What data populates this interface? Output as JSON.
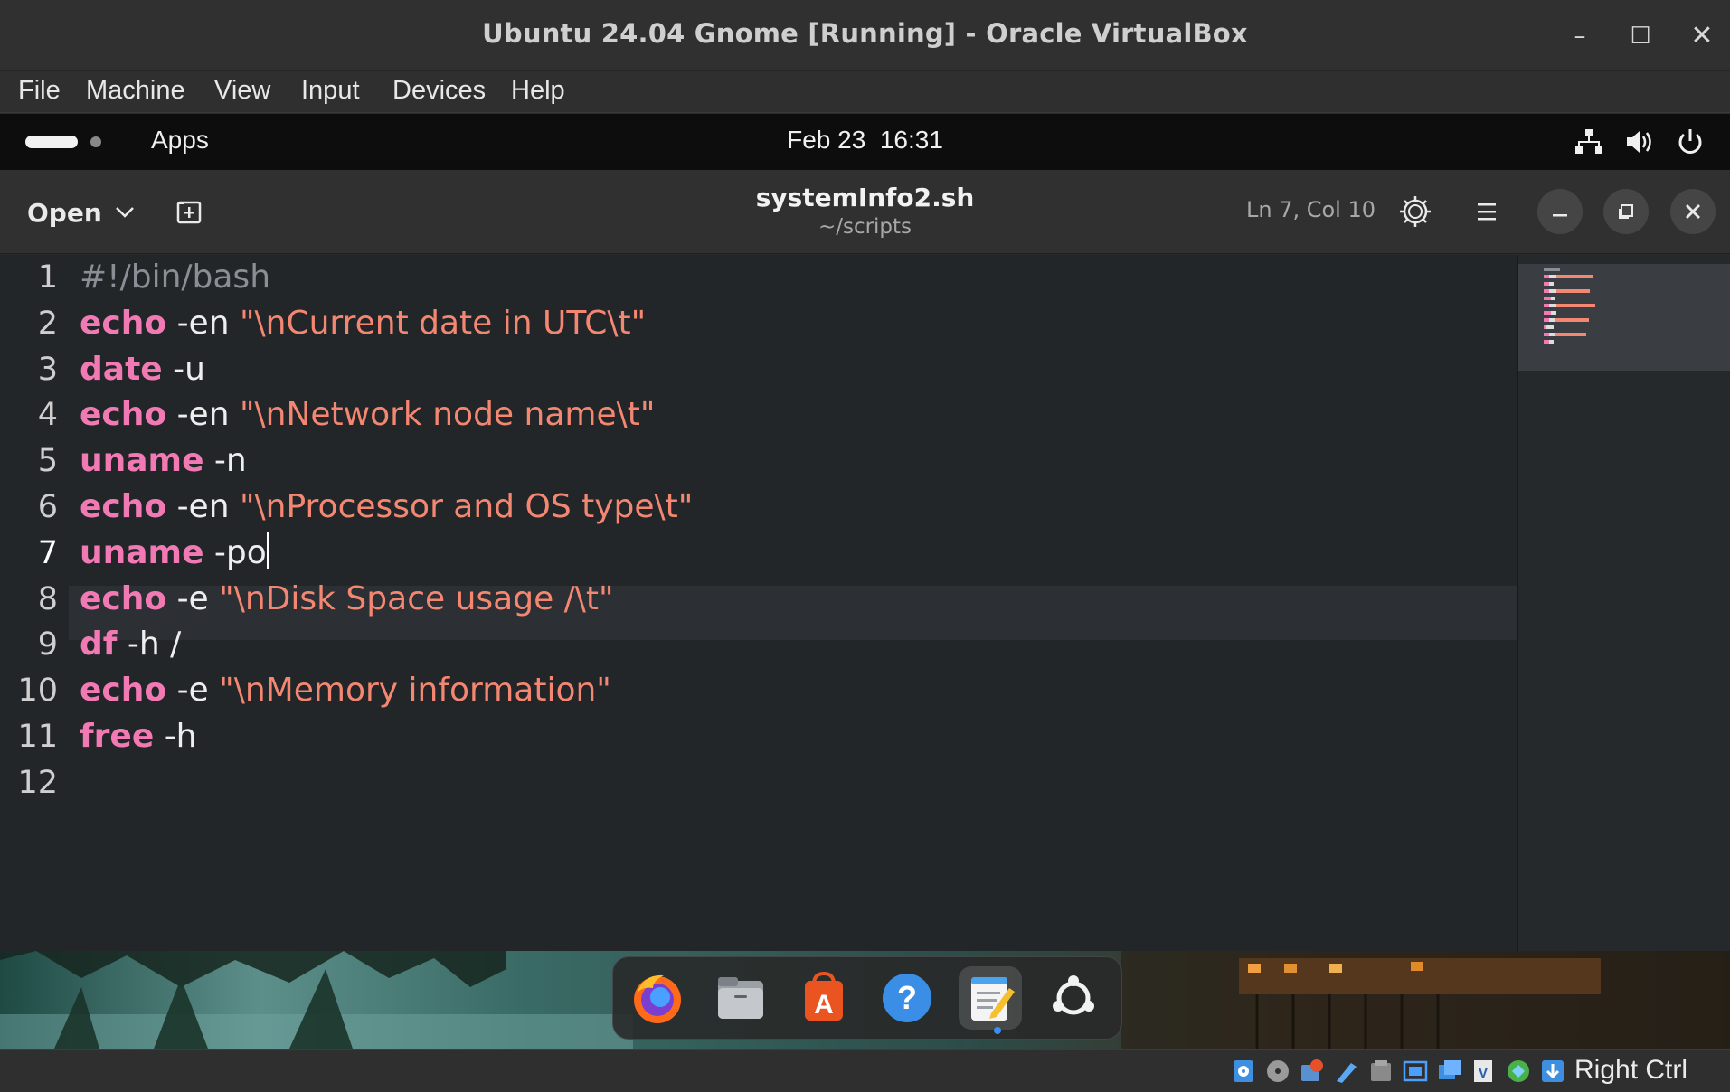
{
  "window": {
    "title": "Ubuntu 24.04 Gnome [Running] - Oracle VirtualBox",
    "controls": {
      "minimize": "–",
      "maximize": "☐",
      "close": "✕"
    }
  },
  "vbox_menu": [
    "File",
    "Machine",
    "View",
    "Input",
    "Devices",
    "Help"
  ],
  "gnome_topbar": {
    "apps_label": "Apps",
    "date": "Feb 23",
    "time": "16:31",
    "tray_icons": [
      "network-icon",
      "volume-icon",
      "power-icon"
    ]
  },
  "gedit": {
    "open_label": "Open",
    "filename": "systemInfo2.sh",
    "path": "~/scripts",
    "cursor_position": "Ln 7, Col 10"
  },
  "editor": {
    "active_line": 7,
    "lines": [
      {
        "num": "1",
        "tokens": [
          {
            "t": "cmt",
            "v": "#!/bin/bash"
          }
        ]
      },
      {
        "num": "2",
        "tokens": [
          {
            "t": "kw",
            "v": "echo"
          },
          {
            "t": "arg",
            "v": " -en "
          },
          {
            "t": "str",
            "v": "\"\\nCurrent date in UTC\\t\""
          }
        ]
      },
      {
        "num": "3",
        "tokens": [
          {
            "t": "kw",
            "v": "date"
          },
          {
            "t": "arg",
            "v": " -u"
          }
        ]
      },
      {
        "num": "4",
        "tokens": [
          {
            "t": "kw",
            "v": "echo"
          },
          {
            "t": "arg",
            "v": " -en "
          },
          {
            "t": "str",
            "v": "\"\\nNetwork node name\\t\""
          }
        ]
      },
      {
        "num": "5",
        "tokens": [
          {
            "t": "kw",
            "v": "uname"
          },
          {
            "t": "arg",
            "v": " -n"
          }
        ]
      },
      {
        "num": "6",
        "tokens": [
          {
            "t": "kw",
            "v": "echo"
          },
          {
            "t": "arg",
            "v": " -en "
          },
          {
            "t": "str",
            "v": "\"\\nProcessor and OS type\\t\""
          }
        ]
      },
      {
        "num": "7",
        "tokens": [
          {
            "t": "kw",
            "v": "uname"
          },
          {
            "t": "arg",
            "v": " -po"
          }
        ]
      },
      {
        "num": "8",
        "tokens": [
          {
            "t": "kw",
            "v": "echo"
          },
          {
            "t": "arg",
            "v": " -e "
          },
          {
            "t": "str",
            "v": "\"\\nDisk Space usage /\\t\""
          }
        ]
      },
      {
        "num": "9",
        "tokens": [
          {
            "t": "kw",
            "v": "df"
          },
          {
            "t": "arg",
            "v": " -h /"
          }
        ]
      },
      {
        "num": "10",
        "tokens": [
          {
            "t": "kw",
            "v": "echo"
          },
          {
            "t": "arg",
            "v": " -e "
          },
          {
            "t": "str",
            "v": "\"\\nMemory information\""
          }
        ]
      },
      {
        "num": "11",
        "tokens": [
          {
            "t": "kw",
            "v": "free"
          },
          {
            "t": "arg",
            "v": " -h"
          }
        ]
      },
      {
        "num": "12",
        "tokens": []
      }
    ]
  },
  "dock": {
    "apps": [
      "firefox-icon",
      "files-icon",
      "app-center-icon",
      "help-icon",
      "text-editor-icon",
      "ubuntu-logo-icon"
    ],
    "active": "text-editor-icon"
  },
  "vbox_status": {
    "host_key": "Right Ctrl",
    "icons": [
      "hard-disk-icon",
      "optical-drive-icon",
      "audio-icon",
      "network-adapter-icon",
      "usb-icon",
      "shared-folders-icon",
      "display-icon",
      "capture-icon",
      "virtualization-icon",
      "mouse-integration-icon",
      "keyboard-capture-icon"
    ]
  },
  "colors": {
    "keyword": "#f27ab4",
    "string": "#f48771",
    "comment": "#8a8f96",
    "editor_bg": "#232629",
    "accent": "#3b8ef5"
  }
}
